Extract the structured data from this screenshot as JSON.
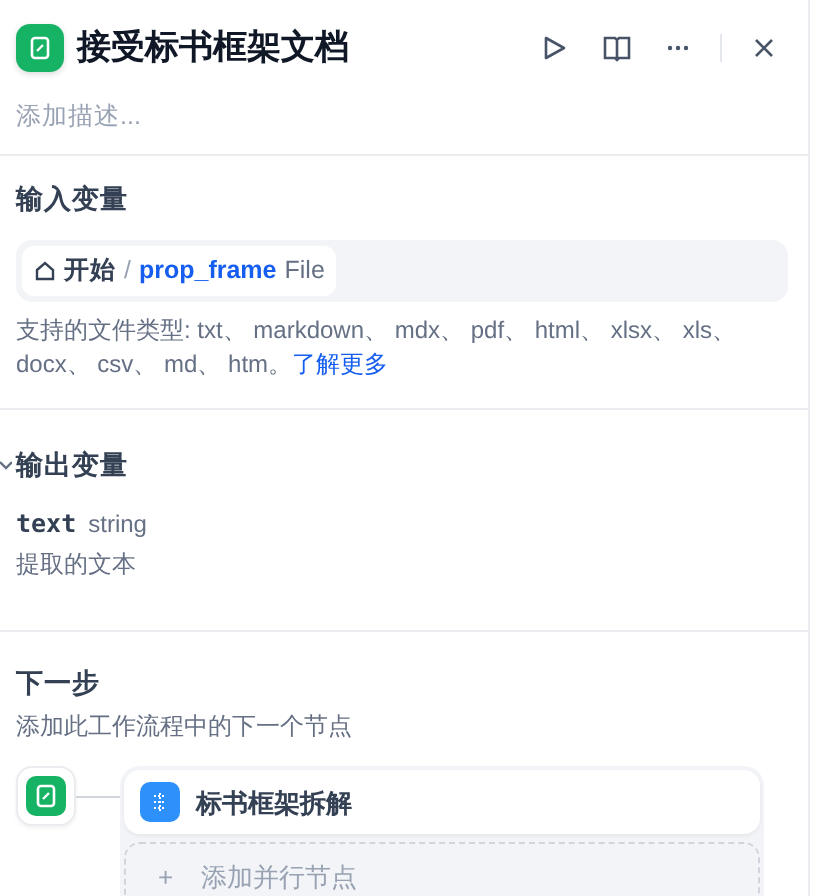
{
  "header": {
    "title": "接受标书框架文档",
    "description": {
      "placeholder": "添加描述..."
    }
  },
  "input_variables": {
    "title": "输入变量",
    "variable": {
      "source": "开始",
      "separator": "/",
      "name": "prop_frame",
      "type": "File"
    },
    "hint": "支持的文件类型: txt、 markdown、 mdx、 pdf、 html、 xlsx、 xls、 docx、 csv、 md、 htm。",
    "link": "了解更多"
  },
  "output_variables": {
    "title": "输出变量",
    "expanded": true,
    "items": [
      {
        "name": "text",
        "type": "string",
        "description": "提取的文本"
      }
    ]
  },
  "next_step": {
    "title": "下一步",
    "subtitle": "添加此工作流程中的下一个节点",
    "nodes": [
      {
        "label": "标书框架拆解"
      }
    ],
    "add_parallel": {
      "icon": "+",
      "label": "添加并行节点"
    }
  }
}
